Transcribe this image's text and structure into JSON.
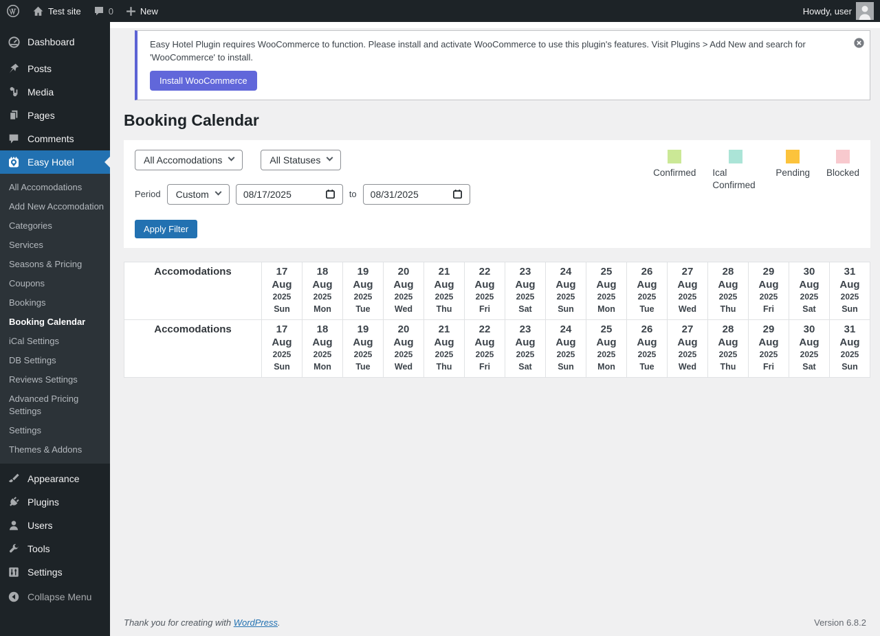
{
  "admin_bar": {
    "site_name": "Test site",
    "comments_count": "0",
    "new_label": "New",
    "howdy": "Howdy, user"
  },
  "sidebar": {
    "items": [
      {
        "label": "Dashboard"
      },
      {
        "label": "Posts"
      },
      {
        "label": "Media"
      },
      {
        "label": "Pages"
      },
      {
        "label": "Comments"
      },
      {
        "label": "Easy Hotel"
      },
      {
        "label": "Appearance"
      },
      {
        "label": "Plugins"
      },
      {
        "label": "Users"
      },
      {
        "label": "Tools"
      },
      {
        "label": "Settings"
      }
    ],
    "submenu": [
      {
        "label": "All Accomodations",
        "active": false
      },
      {
        "label": "Add New Accomodation",
        "active": false
      },
      {
        "label": "Categories",
        "active": false
      },
      {
        "label": "Services",
        "active": false
      },
      {
        "label": "Seasons & Pricing",
        "active": false
      },
      {
        "label": "Coupons",
        "active": false
      },
      {
        "label": "Bookings",
        "active": false
      },
      {
        "label": "Booking Calendar",
        "active": true
      },
      {
        "label": "iCal Settings",
        "active": false
      },
      {
        "label": "DB Settings",
        "active": false
      },
      {
        "label": "Reviews Settings",
        "active": false
      },
      {
        "label": "Advanced Pricing Settings",
        "active": false
      },
      {
        "label": "Settings",
        "active": false
      },
      {
        "label": "Themes & Addons",
        "active": false
      }
    ],
    "collapse_label": "Collapse Menu"
  },
  "notice": {
    "message": "Easy Hotel Plugin requires WooCommerce to function. Please install and activate WooCommerce to use this plugin's features. Visit Plugins > Add New and search for 'WooCommerce' to install.",
    "button_label": "Install WooCommerce"
  },
  "page": {
    "title": "Booking Calendar"
  },
  "filters": {
    "accommodation_select": "All Accomodations",
    "status_select": "All Statuses",
    "period_label": "Period",
    "period_select": "Custom",
    "date_from": "08/17/2025",
    "to_label": "to",
    "date_to": "08/31/2025",
    "apply_button": "Apply Filter"
  },
  "legend": {
    "items": [
      {
        "label": "Confirmed",
        "color": "#cbe896"
      },
      {
        "label": "Ical Confirmed",
        "color": "#abe4d7"
      },
      {
        "label": "Pending",
        "color": "#fcc33c"
      },
      {
        "label": "Blocked",
        "color": "#f8c9ce"
      }
    ]
  },
  "calendar": {
    "header": "Accomodations",
    "days": [
      {
        "day": "17",
        "month": "Aug",
        "year": "2025",
        "weekday": "Sun"
      },
      {
        "day": "18",
        "month": "Aug",
        "year": "2025",
        "weekday": "Mon"
      },
      {
        "day": "19",
        "month": "Aug",
        "year": "2025",
        "weekday": "Tue"
      },
      {
        "day": "20",
        "month": "Aug",
        "year": "2025",
        "weekday": "Wed"
      },
      {
        "day": "21",
        "month": "Aug",
        "year": "2025",
        "weekday": "Thu"
      },
      {
        "day": "22",
        "month": "Aug",
        "year": "2025",
        "weekday": "Fri"
      },
      {
        "day": "23",
        "month": "Aug",
        "year": "2025",
        "weekday": "Sat"
      },
      {
        "day": "24",
        "month": "Aug",
        "year": "2025",
        "weekday": "Sun"
      },
      {
        "day": "25",
        "month": "Aug",
        "year": "2025",
        "weekday": "Mon"
      },
      {
        "day": "26",
        "month": "Aug",
        "year": "2025",
        "weekday": "Tue"
      },
      {
        "day": "27",
        "month": "Aug",
        "year": "2025",
        "weekday": "Wed"
      },
      {
        "day": "28",
        "month": "Aug",
        "year": "2025",
        "weekday": "Thu"
      },
      {
        "day": "29",
        "month": "Aug",
        "year": "2025",
        "weekday": "Fri"
      },
      {
        "day": "30",
        "month": "Aug",
        "year": "2025",
        "weekday": "Sat"
      },
      {
        "day": "31",
        "month": "Aug",
        "year": "2025",
        "weekday": "Sun"
      }
    ]
  },
  "footer": {
    "thanks_prefix": "Thank you for creating with ",
    "link_label": "WordPress",
    "thanks_suffix": ".",
    "version": "Version 6.8.2"
  },
  "colors": {
    "admin_dark": "#1d2327",
    "submenu_dark": "#2c3338",
    "wp_blue": "#2271b1",
    "notice_accent": "#5c63d4",
    "install_button": "#6167da",
    "page_background": "#f0f0f1"
  }
}
